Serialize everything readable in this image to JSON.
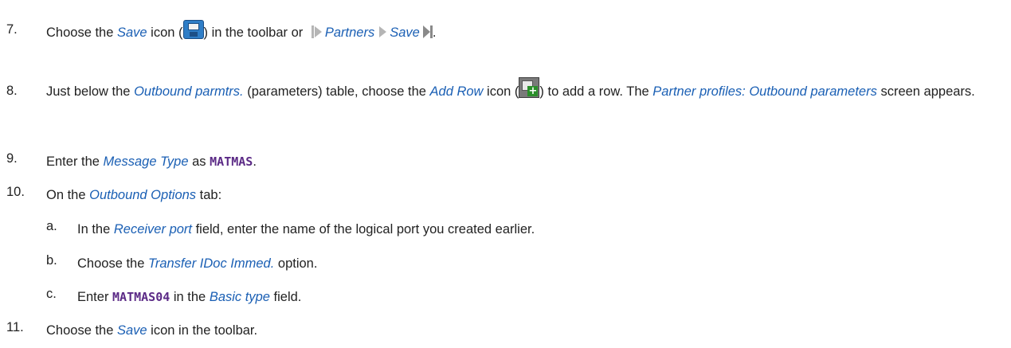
{
  "steps": [
    {
      "number": "7.",
      "t1": "Choose the ",
      "save": "Save",
      "t2": " icon (",
      "t3": ") in the toolbar or ",
      "partners": "Partners",
      "path_save": "Save",
      "t4": "."
    },
    {
      "number": "8.",
      "t1": "Just below the ",
      "outbound_parmtrs": "Outbound parmtrs.",
      "t2": " (parameters) table, choose the ",
      "add_row": "Add Row",
      "t3": " icon (",
      "t4": ") to add a row. The ",
      "screen_name": "Partner profiles: Outbound parameters",
      "t5": " screen appears."
    },
    {
      "number": "9.",
      "t1": "Enter the ",
      "message_type": "Message Type",
      "t2": " as ",
      "code": "MATMAS",
      "t3": "."
    },
    {
      "number": "10.",
      "t1": "On the ",
      "tab": "Outbound Options",
      "t2": " tab:",
      "substeps": [
        {
          "letter": "a.",
          "t1": "In the ",
          "field": "Receiver port",
          "t2": " field, enter the name of the logical port you created earlier."
        },
        {
          "letter": "b.",
          "t1": "Choose the ",
          "option": "Transfer IDoc Immed.",
          "t2": " option."
        },
        {
          "letter": "c.",
          "t1": "Enter ",
          "code": "MATMAS04",
          "t2": " in the ",
          "field": "Basic type",
          "t3": " field."
        }
      ]
    },
    {
      "number": "11.",
      "t1": "Choose the ",
      "save": "Save",
      "t2": " icon in the toolbar."
    }
  ],
  "icons": {
    "save": "save-icon",
    "add_row": "add-row-icon",
    "menu_path": "menu-path-arrow-icon"
  },
  "colors": {
    "ui_term": "#1a5fb4",
    "code": "#5b2a86",
    "text": "#222222"
  }
}
